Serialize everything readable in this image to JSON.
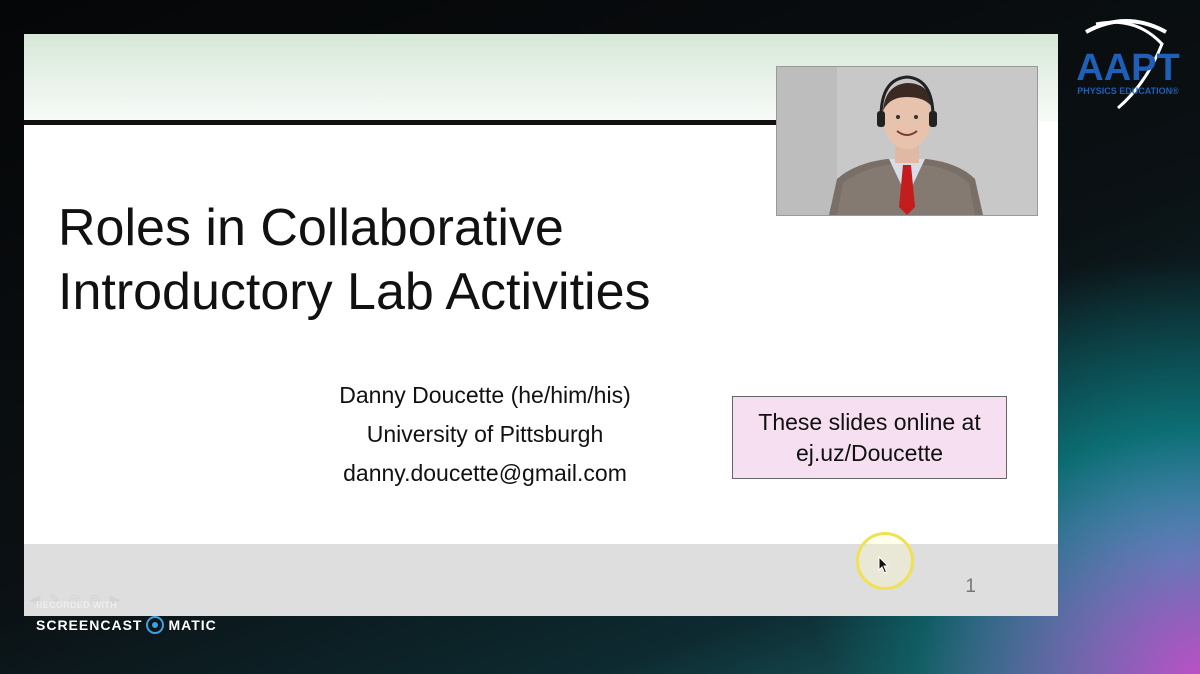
{
  "slide": {
    "title_lines": [
      "Roles in Collaborative",
      "Introductory Lab Activities"
    ],
    "author": {
      "name": "Danny Doucette (he/him/his)",
      "affiliation": "University of Pittsburgh",
      "email": "danny.doucette@gmail.com"
    },
    "note_lines": [
      "These slides online at",
      "ej.uz/Doucette"
    ],
    "page_number": "1"
  },
  "logo": {
    "main": "AAPT",
    "tagline": "PHYSICS EDUCATION®"
  },
  "recorder": {
    "recorded_with": "RECORDED WITH",
    "brand_left": "SCREENCAST",
    "brand_right": "MATIC"
  },
  "nav_icons": [
    "arrow-left-icon",
    "pen-icon",
    "zoom-icon",
    "menu-icon",
    "arrow-right-icon"
  ],
  "colors": {
    "note_background": "#f5dff0",
    "cursor_ring": "#f0e055",
    "logo_blue": "#1f5fb8",
    "tie_red": "#c41d1d"
  }
}
